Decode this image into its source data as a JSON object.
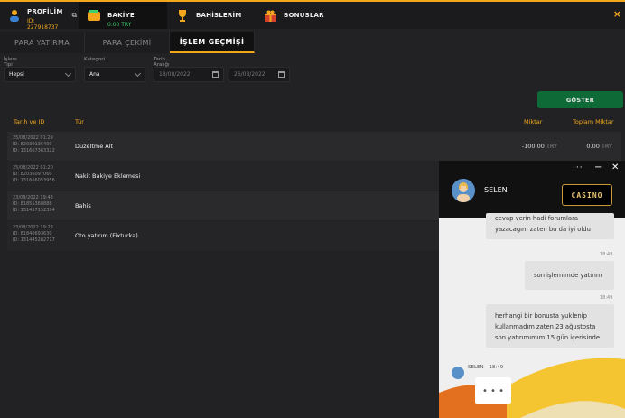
{
  "topbar": {
    "profile_label": "PROFİLİM",
    "profile_id": "ID: 227918737",
    "balance_label": "BAKİYE",
    "balance_value": "0.00 TRY",
    "bets_label": "BAHİSLERİM",
    "bonus_label": "BONUSLAR",
    "close": "×"
  },
  "tabs": [
    {
      "label": "PARA YATIRMA"
    },
    {
      "label": "PARA ÇEKİMİ"
    },
    {
      "label": "İŞLEM GEÇMİŞİ"
    }
  ],
  "filters": {
    "type_label": "İşlem Tipi",
    "type_value": "Hepsi",
    "category_label": "Kategori",
    "category_value": "Ana",
    "date_label": "Tarih Aralığı",
    "date_from": "18/08/2022",
    "date_to": "26/08/2022"
  },
  "show_button": "GÖSTER",
  "table": {
    "headers": [
      "Tarih ve ID",
      "Tür",
      "Miktar",
      "Toplam Miktar"
    ],
    "rows": [
      {
        "datetime": "25/08/2022 01:29",
        "id1": "ID: 82039135400",
        "id2": "ID: 131667363322",
        "type": "Düzeltme Alt",
        "amount": "-100.00",
        "amount_cur": "TRY",
        "total": "0.00",
        "total_cur": "TRY"
      },
      {
        "datetime": "25/08/2022 01:20",
        "id1": "ID: 82036097060",
        "id2": "ID: 131666053956",
        "type": "Nakit Bakiye Eklemesi",
        "amount": "",
        "amount_cur": "",
        "total": "",
        "total_cur": ""
      },
      {
        "datetime": "23/08/2022 19:43",
        "id1": "ID: 81855368888",
        "id2": "ID: 131457152394",
        "type": "Bahis",
        "amount": "",
        "amount_cur": "",
        "total": "",
        "total_cur": ""
      },
      {
        "datetime": "23/08/2022 19:23",
        "id1": "ID: 81840693630",
        "id2": "ID: 131445282717",
        "type": "Oto yatırım (Fixturka)",
        "amount": "",
        "amount_cur": "",
        "total": "",
        "total_cur": ""
      }
    ]
  },
  "chat": {
    "agent_name": "SELEN",
    "header_dots": "···",
    "header_min": "−",
    "header_close": "✕",
    "logo_text": "CASINO",
    "messages": [
      {
        "text_lines": [
          "cevap verin hadi forumlara",
          "yazacagım zaten bu da iyi oldu"
        ]
      },
      {
        "time": "18:48"
      },
      {
        "text_lines": [
          "son işlemimde yatırım"
        ]
      },
      {
        "time": "18:49"
      },
      {
        "text_lines": [
          "herhangi bir bonusta yuklenip",
          "kullanmadım zaten 23 ağustosta",
          "son yatırımımım 15 gün içerisinde"
        ]
      }
    ],
    "typing_sender": "SELEN",
    "typing_time": "18:49",
    "typing_dots": "• • •"
  },
  "colors": {
    "accent": "#f4a71d",
    "show_button": "#0e6b37",
    "balance": "#3ecf6e"
  }
}
